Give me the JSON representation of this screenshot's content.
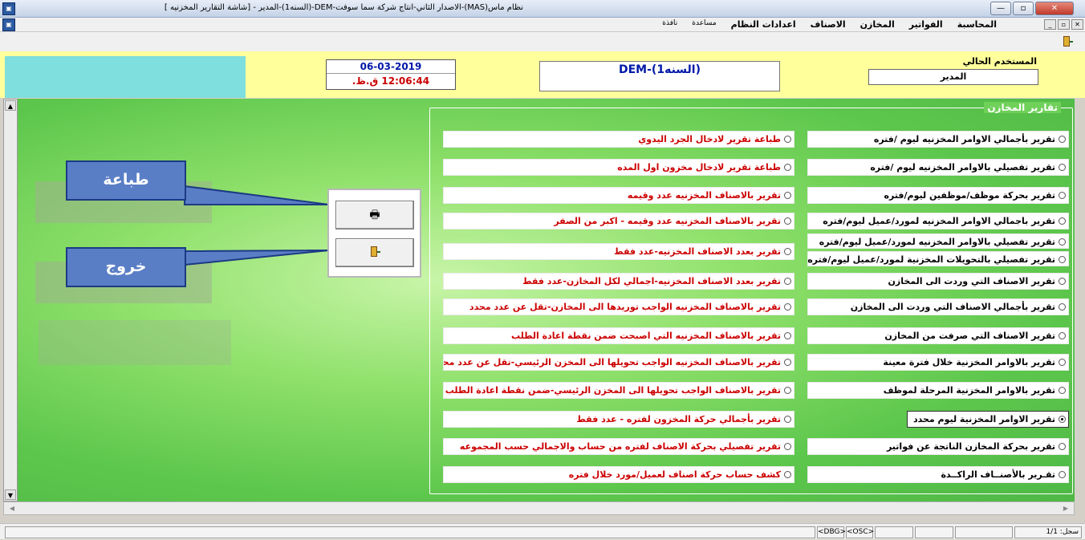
{
  "window": {
    "title": "نظام ماس(MAS)-الاصدار الثاني-انتاج شركة سما سوفت-DEM-(السنه1)-المدير - [شاشة التقارير المخزنيه ]",
    "controls": {
      "minimize": "—",
      "maximize": "▫",
      "close": "✕"
    }
  },
  "menu": {
    "items": [
      "المحاسبة",
      "الفواتير",
      "المخازن",
      "الاصناف",
      "اعدادات النظام",
      "مساعدة",
      "نافذة"
    ]
  },
  "mdi_controls": {
    "close": "✕",
    "restore": "▫",
    "minimize": "_"
  },
  "header": {
    "date": "06-03-2019",
    "time": "12:06:44 ق.ظ.",
    "company": "DEM-(السنه1)",
    "user_label": "المستخدم الحالي",
    "user_value": "المدير"
  },
  "panel": {
    "legend": "تقارير المخازن",
    "right_options": [
      "تقرير بأجمالي الاوامر المخزنيه ليوم /فتره",
      "تقرير تفصيلي بالاوامر المخزنيه ليوم /فتره",
      "تقرير بحركة موظف/موظفين ليوم/فتره",
      "تقرير باجمالي الاوامر المخزنيه لمورد/عميل ليوم/فتره",
      "تقرير تفصيلي بالاوامر المخزنيه لمورد/عميل ليوم/فتره",
      "تقرير تفصيلي بالتحويلات المخزنية لمورد/عميل ليوم/فتره",
      "تقرير الاصناف التي وردت الى المخازن",
      "تقرير بأجمالي الاصناف التي وردت الى المخازن",
      "تقرير الاصناف التي صرفت من المخازن",
      "تقرير بالاوامر المخزنية خلال فترة معينة",
      "تقرير بالاوامر المخزنية المرحلة لموظف",
      "تقرير الاوامر المخزنية ليوم محدد",
      "تقرير بحركة المخازن الناتجة عن فواتير",
      "تقـرير بالأصنــاف الراكــدة"
    ],
    "left_options": [
      "طباعة تقرير لادخال الجرد اليدوي",
      "طباعة تقرير لادخال مخزون اول المده",
      "تقرير بالاصناف المخزنيه عدد وقيمه",
      "تقرير بالاصناف المخزنيه عدد وقيمه - اكبر من الصفر",
      "تقرير بعدد الاصناف المخزنيه-عدد فقط",
      "تقرير بعدد الاصناف المخزنيه-اجمالي لكل المخازن-عدد فقط",
      "تقرير بالاصناف المخزنيه الواجب توريدها الى المخازن-تقل عن عدد محدد",
      "تقرير بالاصناف المخزنيه التي اصبحت ضمن نقطة اعادة الطلب",
      "تقرير بالاصناف المخزنيه الواجب تحويلها الى المخزن الرئيسي-تقل عن عدد محدد",
      "تقرير بالاصناف الواجب تحويلها الى المخزن الرئيسي-ضمن نقطة اعادة الطلب",
      "تقرير بأجمالي حركة المخزون لفتره - عدد فقط",
      "تقرير تفصيلي بحركة الاصناف لفتره من حساب والاجمالي حسب المجموعه",
      "كشف حساب حركة اصناف لعميل/مورد خلال فتره"
    ],
    "selected_right_index": 11
  },
  "actions": {
    "print_label": "طباعة",
    "exit_label": "خروج"
  },
  "status": {
    "record": "سجل: 1/1",
    "dbg": "<DBG>",
    "osc": "<OSC>"
  },
  "colors": {
    "header_bg": "#ffff9c",
    "cyan": "#7fdede",
    "green": "#6fd05a",
    "red_text": "#cc0000",
    "callout": "#5a7ec6"
  }
}
